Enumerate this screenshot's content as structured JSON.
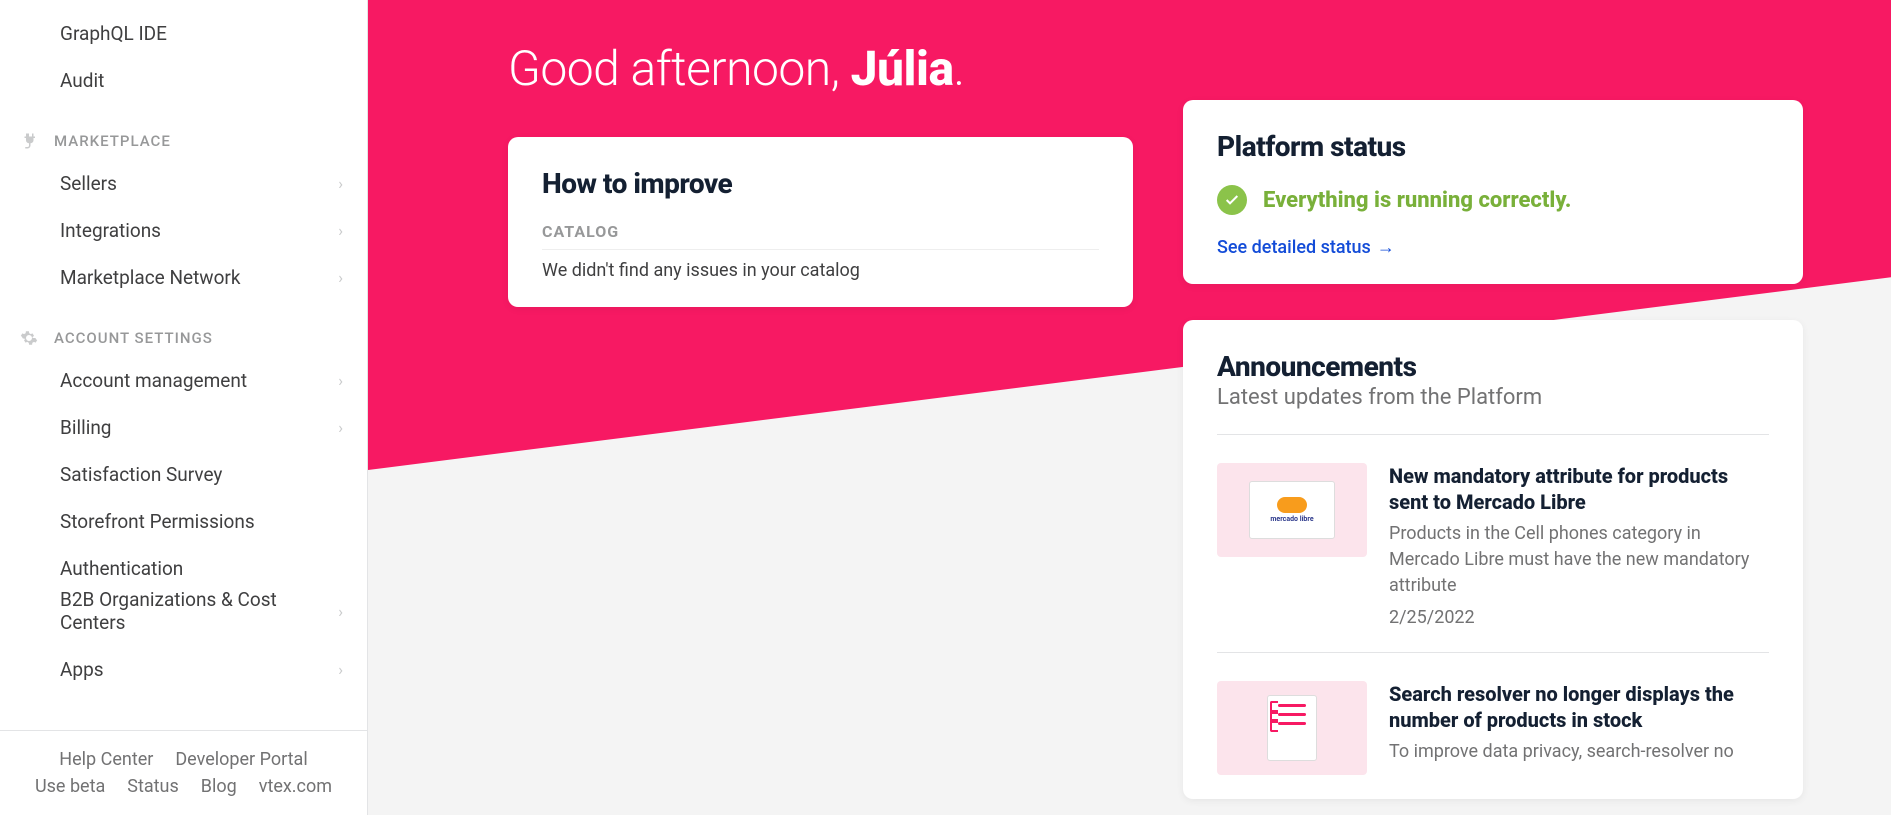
{
  "sidebar": {
    "topItems": [
      {
        "label": "GraphQL IDE",
        "hasChildren": false
      },
      {
        "label": "Audit",
        "hasChildren": false
      }
    ],
    "sections": [
      {
        "header": "MARKETPLACE",
        "icon": "plug",
        "items": [
          {
            "label": "Sellers",
            "hasChildren": true
          },
          {
            "label": "Integrations",
            "hasChildren": true
          },
          {
            "label": "Marketplace Network",
            "hasChildren": true
          }
        ]
      },
      {
        "header": "ACCOUNT SETTINGS",
        "icon": "gear",
        "items": [
          {
            "label": "Account management",
            "hasChildren": true
          },
          {
            "label": "Billing",
            "hasChildren": true
          },
          {
            "label": "Satisfaction Survey",
            "hasChildren": false
          },
          {
            "label": "Storefront Permissions",
            "hasChildren": false
          },
          {
            "label": "Authentication",
            "hasChildren": false
          },
          {
            "label": "B2B Organizations & Cost Centers",
            "hasChildren": true
          },
          {
            "label": "Apps",
            "hasChildren": true
          }
        ]
      }
    ],
    "footer": [
      "Help Center",
      "Developer Portal",
      "Use beta",
      "Status",
      "Blog",
      "vtex.com"
    ]
  },
  "greeting": {
    "prefix": "Good afternoon, ",
    "name": "Júlia",
    "suffix": "."
  },
  "improve": {
    "title": "How to improve",
    "sectionLabel": "CATALOG",
    "message": "We didn't find any issues in your catalog"
  },
  "status": {
    "title": "Platform status",
    "message": "Everything is running correctly.",
    "link": "See detailed status"
  },
  "announcements": {
    "title": "Announcements",
    "subtitle": "Latest updates from the Platform",
    "items": [
      {
        "title": "New mandatory attribute for products sent to Mercado Libre",
        "desc": "Products in the Cell phones category in Mercado Libre must have the new mandatory attribute",
        "date": "2/25/2022",
        "thumb": "mercado"
      },
      {
        "title": "Search resolver no longer displays the number of products in stock",
        "desc": "To improve data privacy, search-resolver no",
        "date": "",
        "thumb": "clipboard"
      }
    ]
  }
}
